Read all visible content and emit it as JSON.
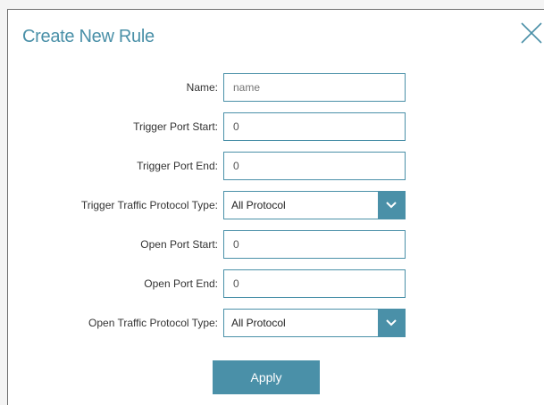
{
  "dialog": {
    "title": "Create New Rule",
    "close_icon": "close-icon"
  },
  "form": {
    "name": {
      "label": "Name:",
      "value": "",
      "placeholder": "name"
    },
    "trigger_port_start": {
      "label": "Trigger Port Start:",
      "value": "0"
    },
    "trigger_port_end": {
      "label": "Trigger Port End:",
      "value": "0"
    },
    "trigger_protocol": {
      "label": "Trigger Traffic Protocol Type:",
      "selected": "All Protocol"
    },
    "open_port_start": {
      "label": "Open Port Start:",
      "value": "0"
    },
    "open_port_end": {
      "label": "Open Port End:",
      "value": "0"
    },
    "open_protocol": {
      "label": "Open Traffic Protocol Type:",
      "selected": "All Protocol"
    }
  },
  "actions": {
    "apply_label": "Apply"
  },
  "colors": {
    "accent": "#4a90a8",
    "title": "#4a90a8"
  }
}
